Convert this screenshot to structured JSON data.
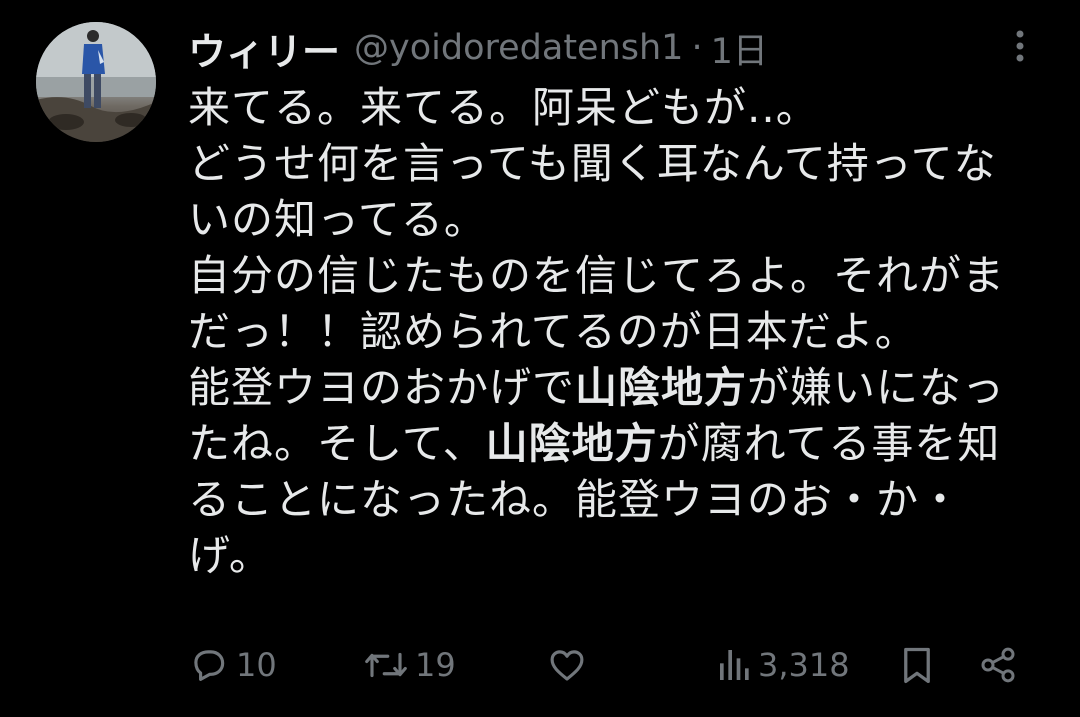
{
  "tweet": {
    "display_name": "ウィリー",
    "handle": "@yoidoredatensh1",
    "separator": "·",
    "time": "1日",
    "lines": [
      [
        {
          "t": "来てる。来てる。阿呆どもが..。"
        }
      ],
      [
        {
          "t": "どうせ何を言っても聞く耳なんて持ってな"
        }
      ],
      [
        {
          "t": "いの知ってる。"
        }
      ],
      [
        {
          "t": "自分の信じたものを信じてろよ。それがま"
        }
      ],
      [
        {
          "t": "だっ！！認められてるのが日本だよ。"
        }
      ],
      [
        {
          "t": "能登ウヨのおかげで"
        },
        {
          "t": "山陰地方",
          "b": true
        },
        {
          "t": "が嫌いになっ"
        }
      ],
      [
        {
          "t": "たね。そして、"
        },
        {
          "t": "山陰地方",
          "b": true
        },
        {
          "t": "が腐れてる事を知"
        }
      ],
      [
        {
          "t": "ることになったね。能登ウヨのお・か・"
        }
      ],
      [
        {
          "t": "げ。"
        }
      ]
    ]
  },
  "actions": {
    "reply_count": "10",
    "retweet_count": "19",
    "views_count": "3,318"
  },
  "icons": {
    "avatar": "avatar-photo",
    "more": "more-vertical-icon",
    "reply": "reply-bubble-icon",
    "retweet": "retweet-icon",
    "like": "heart-icon",
    "views": "views-bar-chart-icon",
    "bookmark": "bookmark-icon",
    "share": "share-icon"
  },
  "colors": {
    "background": "#000000",
    "text": "#e7e9ea",
    "secondary": "#71767b"
  }
}
